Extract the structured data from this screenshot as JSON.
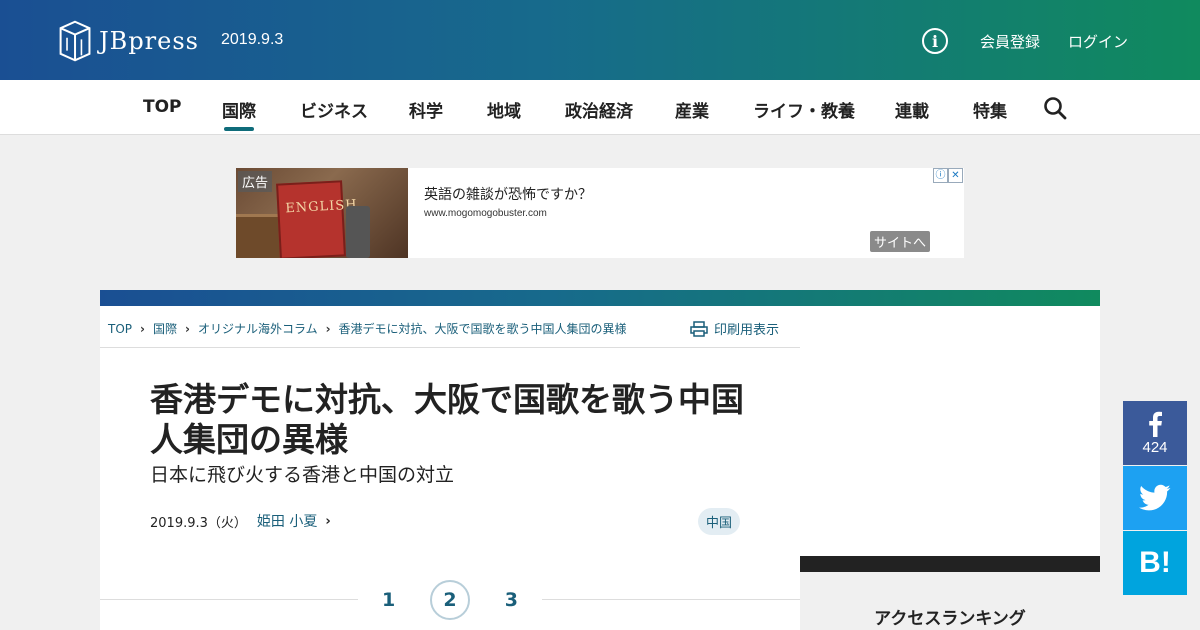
{
  "header": {
    "logo_text": "JBpress",
    "date": "2019.9.3",
    "info_icon": "info-icon",
    "register_label": "会員登録",
    "login_label": "ログイン"
  },
  "nav": {
    "items": [
      "TOP",
      "国際",
      "ビジネス",
      "科学",
      "地域",
      "政治経済",
      "産業",
      "ライフ・教養",
      "連載",
      "特集"
    ],
    "active": "国際",
    "search_icon": "search-icon"
  },
  "ad": {
    "label": "広告",
    "book_text": "ENGLISH",
    "title": "英語の雑談が恐怖ですか？",
    "url": "www.mogomogobuster.com",
    "button": "サイトへ",
    "choices_icon": "ⓘ",
    "close_icon": "✕"
  },
  "breadcrumb": {
    "items": [
      "TOP",
      "国際",
      "オリジナル海外コラム",
      "香港デモに対抗、大阪で国歌を歌う中国人集団の異様"
    ],
    "separator": "›"
  },
  "print_label": "印刷用表示",
  "article": {
    "title": "香港デモに対抗、大阪で国歌を歌う中国人集団の異様",
    "subtitle": "日本に飛び火する香港と中国の対立",
    "date": "2019.9.3（火）",
    "author": "姫田 小夏",
    "author_arrow": "›",
    "tag": "中国"
  },
  "pager": {
    "pages": [
      "1",
      "2",
      "3"
    ],
    "current": "2"
  },
  "sidebar": {
    "ranking_title": "アクセスランキング"
  },
  "social": {
    "facebook_count": "424",
    "hatena_label": "B!"
  },
  "colors": {
    "header_gradient_start": "#1a4f93",
    "header_gradient_end": "#108a5e",
    "link": "#1a5f7a",
    "facebook": "#3b5a9a",
    "twitter": "#1da1f2",
    "hatena": "#00a4de"
  }
}
